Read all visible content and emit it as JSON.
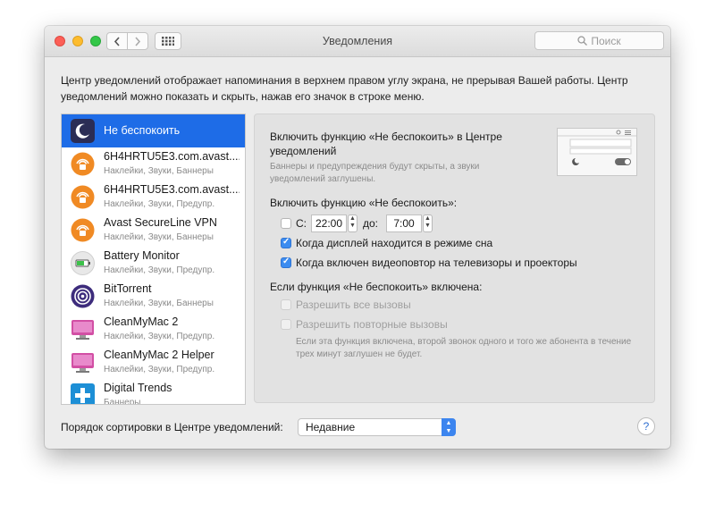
{
  "window": {
    "title": "Уведомления"
  },
  "search": {
    "placeholder": "Поиск"
  },
  "description": "Центр уведомлений отображает напоминания в верхнем правом углу экрана, не прерывая Вашей работы. Центр уведомлений можно показать и скрыть, нажав его значок в строке меню.",
  "apps": [
    {
      "name": "Не беспокоить",
      "sub": "",
      "icon": "moon-icon",
      "selected": true
    },
    {
      "name": "6H4HRTU5E3.com.avast....",
      "sub": "Наклейки, Звуки, Баннеры",
      "icon": "avast-icon"
    },
    {
      "name": "6H4HRTU5E3.com.avast....",
      "sub": "Наклейки, Звуки, Предупр.",
      "icon": "avast-icon"
    },
    {
      "name": "Avast SecureLine VPN",
      "sub": "Наклейки, Звуки, Баннеры",
      "icon": "avast-icon"
    },
    {
      "name": "Battery Monitor",
      "sub": "Наклейки, Звуки, Предупр.",
      "icon": "battery-icon"
    },
    {
      "name": "BitTorrent",
      "sub": "Наклейки, Звуки, Баннеры",
      "icon": "bittorrent-icon"
    },
    {
      "name": "CleanMyMac 2",
      "sub": "Наклейки, Звуки, Предупр.",
      "icon": "cleanmymac-icon"
    },
    {
      "name": "CleanMyMac 2 Helper",
      "sub": "Наклейки, Звуки, Предупр.",
      "icon": "cleanmymac-icon"
    },
    {
      "name": "Digital Trends",
      "sub": "Баннеры",
      "icon": "digital-trends-icon"
    }
  ],
  "dnd": {
    "title": "Включить функцию «Не беспокоить» в Центре уведомлений",
    "note": "Баннеры и предупреждения будут скрыты, а звуки уведомлений заглушены.",
    "enable_label": "Включить функцию «Не беспокоить»:",
    "from_label": "С:",
    "from_time": "22:00",
    "to_label": "до:",
    "to_time": "7:00",
    "sleep_label": "Когда дисплей находится в режиме сна",
    "mirror_label": "Когда включен видеоповтор на телевизоры и проекторы",
    "when_on_label": "Если функция «Не беспокоить» включена:",
    "allow_all_label": "Разрешить все вызовы",
    "repeat_label": "Разрешить повторные вызовы",
    "repeat_note": "Если эта функция включена, второй звонок одного и того же абонента в течение трех минут заглушен не будет.",
    "schedule_checked": false,
    "sleep_checked": true,
    "mirror_checked": true
  },
  "sort": {
    "label": "Порядок сортировки в Центре уведомлений:",
    "value": "Недавние"
  },
  "help": {
    "label": "?"
  },
  "colors": {
    "accent": "#1e6ce7",
    "checkbox": "#3c8cf0",
    "avast": "#f08a24"
  }
}
